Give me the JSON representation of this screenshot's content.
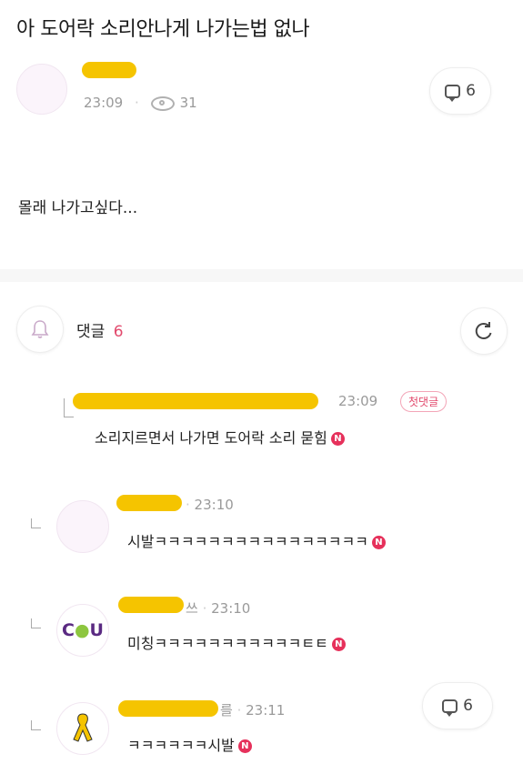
{
  "post": {
    "title": "아 도어락 소리안나게 나가는법 없나",
    "time": "23:09",
    "views": "31",
    "comment_count": "6",
    "body": "몰래 나가고싶다..."
  },
  "comments_header": {
    "label": "댓글",
    "count": "6"
  },
  "comments": [
    {
      "time": "23:09",
      "badge": "첫댓글",
      "text": "소리지르면서 나가면 도어락 소리 묻힘",
      "n": "N"
    },
    {
      "time": "23:10",
      "text": "시발ㅋㅋㅋㅋㅋㅋㅋㅋㅋㅋㅋㅋㅋㅋㅋㅋ",
      "n": "N"
    },
    {
      "name_tail": "쓰",
      "time": "23:10",
      "avatar": "CU",
      "text": "미칭ㅋㅋㅋㅋㅋㅋㅋㅋㅋㅋㅋㅌㅌ",
      "n": "N"
    },
    {
      "name_tail": "를",
      "time": "23:11",
      "text": "ㅋㅋㅋㅋㅋㅋ시발",
      "n": "N"
    }
  ],
  "floating_comment_count": "6",
  "colors": {
    "redaction": "#f5c400",
    "new_badge": "#e6315b",
    "first_badge": "#e24a6d"
  }
}
